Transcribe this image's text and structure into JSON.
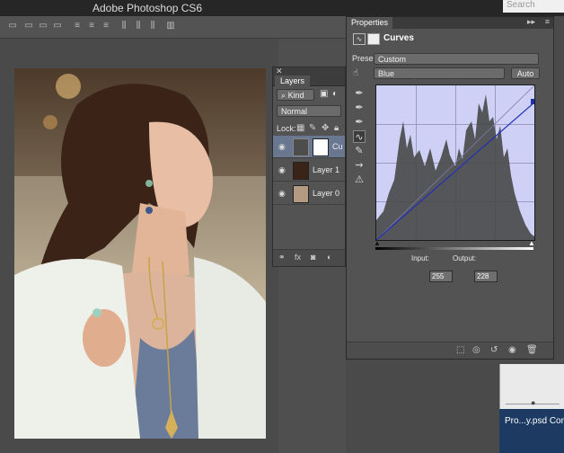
{
  "app": {
    "title": "Adobe Photoshop CS6"
  },
  "search": {
    "placeholder": "Search"
  },
  "layers": {
    "tab": "Layers",
    "filter": "Kind",
    "blend_mode": "Normal",
    "lock_label": "Lock:",
    "items": [
      {
        "name": "Cu"
      },
      {
        "name": "Layer 1"
      },
      {
        "name": "Layer 0"
      }
    ]
  },
  "properties": {
    "tab": "Properties",
    "adjustment_title": "Curves",
    "preset_label": "Preset:",
    "preset_value": "Custom",
    "channel": "Blue",
    "auto_button": "Auto",
    "input_label": "Input:",
    "input_value": "255",
    "output_label": "Output:",
    "output_value": "228"
  },
  "document": {
    "tab_title": "Pro...y.psd  Con..."
  },
  "colors": {
    "curve_line": "#1f2fb8",
    "graph_bg": "#cfd0f5",
    "histogram": "#4b4b4b"
  }
}
